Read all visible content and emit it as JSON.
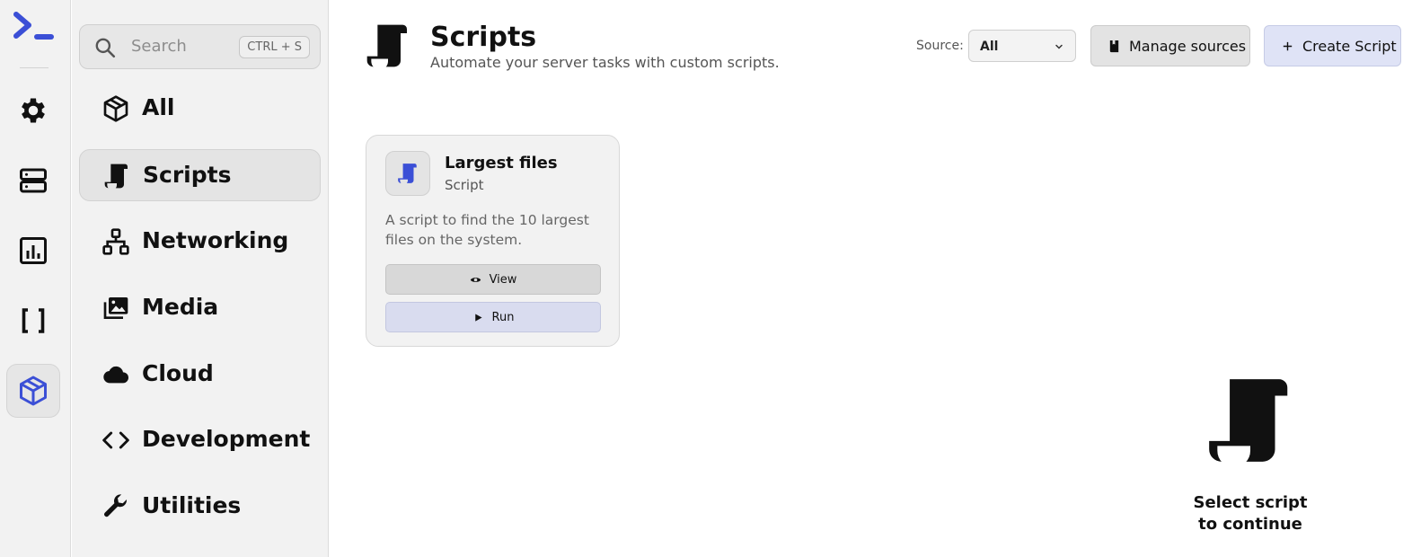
{
  "rail": {
    "accent_color": "#3b4fd6",
    "items": [
      {
        "icon": "gear-icon"
      },
      {
        "icon": "server-icon"
      },
      {
        "icon": "chart-icon"
      },
      {
        "icon": "brackets-icon"
      },
      {
        "icon": "package-icon",
        "active": true
      }
    ]
  },
  "sidebar": {
    "search": {
      "placeholder": "Search",
      "shortcut": "CTRL + S"
    },
    "items": [
      {
        "label": "All",
        "icon": "package-icon"
      },
      {
        "label": "Scripts",
        "icon": "scroll-icon",
        "active": true
      },
      {
        "label": "Networking",
        "icon": "network-icon"
      },
      {
        "label": "Media",
        "icon": "images-icon"
      },
      {
        "label": "Cloud",
        "icon": "cloud-icon"
      },
      {
        "label": "Development",
        "icon": "code-icon"
      },
      {
        "label": "Utilities",
        "icon": "wrench-icon"
      }
    ]
  },
  "header": {
    "title": "Scripts",
    "subtitle": "Automate your server tasks with custom scripts.",
    "source_label": "Source:",
    "source_value": "All",
    "manage_label": "Manage sources",
    "create_label": "Create Script"
  },
  "cards": [
    {
      "title": "Largest files",
      "type": "Script",
      "description": "A script to find the 10 largest files on the system.",
      "view_label": "View",
      "run_label": "Run"
    }
  ],
  "empty_state": {
    "line1": "Select script",
    "line2": "to continue"
  }
}
